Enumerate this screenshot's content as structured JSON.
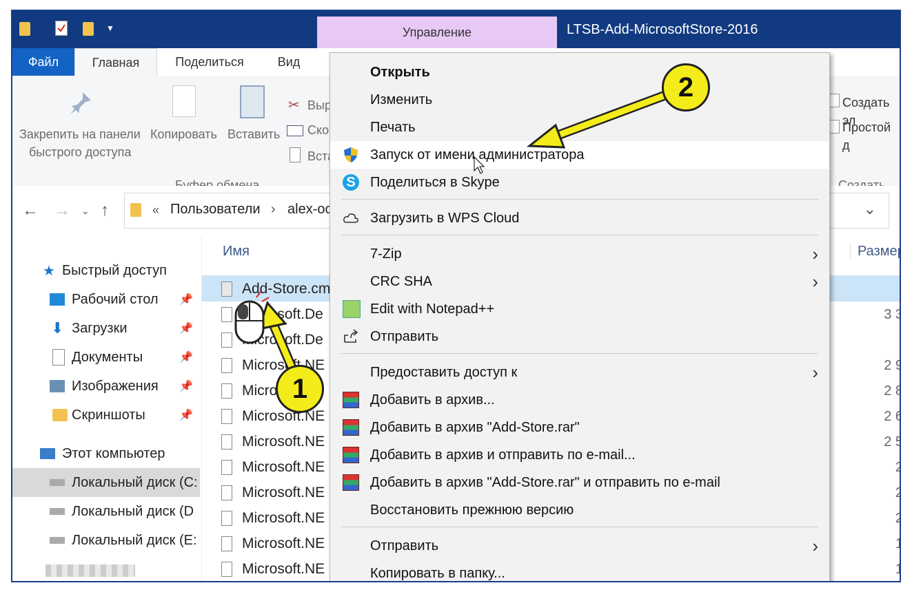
{
  "window": {
    "manage_tab": "Управление",
    "title": "LTSB-Add-MicrosoftStore-2016"
  },
  "tabs": [
    "Файл",
    "Главная",
    "Поделиться",
    "Вид"
  ],
  "ribbon": {
    "pin_label_1": "Закрепить на панели",
    "pin_label_2": "быстрого доступа",
    "copy": "Копировать",
    "paste": "Вставить",
    "cut_partial": "Выр",
    "copy_path_partial": "Ско",
    "paste_shortcut_partial": "Вста",
    "clipboard_group": "Буфер обмена",
    "new_item_partial": "Создать эл",
    "easy_access_partial": "Простой д",
    "create_group": "Создать"
  },
  "address": {
    "sep": "«",
    "crumb1": "Пользователи",
    "crumb2": "alex-oc"
  },
  "sidebar": {
    "quick_access": "Быстрый доступ",
    "items": [
      "Рабочий стол",
      "Загрузки",
      "Документы",
      "Изображения",
      "Скриншоты"
    ],
    "this_pc": "Этот компьютер",
    "drives": [
      "Локальный диск (C:",
      "Локальный диск (D",
      "Локальный диск (E:"
    ]
  },
  "filelist": {
    "col_name": "Имя",
    "col_size": "Размер",
    "rows": [
      {
        "name": "Add-Store.cm",
        "size": ""
      },
      {
        "name": "Microsoft.De",
        "size": "3 3"
      },
      {
        "name": "Microsoft.De",
        "size": ""
      },
      {
        "name": "Microsoft.NE",
        "size": "2 9"
      },
      {
        "name": "Micro",
        "size": "2 8"
      },
      {
        "name": "Microsoft.NE",
        "size": "2 6"
      },
      {
        "name": "Microsoft.NE",
        "size": "2 5"
      },
      {
        "name": "Microsoft.NE",
        "size": "2"
      },
      {
        "name": "Microsoft.NE",
        "size": "2"
      },
      {
        "name": "Microsoft.NE",
        "size": "2"
      },
      {
        "name": "Microsoft.NE",
        "size": "1"
      },
      {
        "name": "Microsoft.NE",
        "size": "1"
      }
    ]
  },
  "context_menu": {
    "open": "Открыть",
    "edit": "Изменить",
    "print": "Печать",
    "run_as_admin": "Запуск от имени администратора",
    "share_skype": "Поделиться в Skype",
    "wps_cloud": "Загрузить в WPS Cloud",
    "zip7": "7-Zip",
    "crc": "CRC SHA",
    "notepadpp": "Edit with Notepad++",
    "send_share": "Отправить",
    "grant_access": "Предоставить доступ к",
    "add_archive": "Добавить в архив...",
    "add_archive_rar": "Добавить в архив \"Add-Store.rar\"",
    "add_archive_email": "Добавить в архив и отправить по e-mail...",
    "add_archive_rar_email": "Добавить в архив \"Add-Store.rar\" и отправить по e-mail",
    "restore": "Восстановить прежнюю версию",
    "send_to": "Отправить",
    "copy_to": "Копировать в папку..."
  },
  "badges": {
    "one": "1",
    "two": "2"
  },
  "colors": {
    "titlebar": "#113a80",
    "file_tab": "#1363c5",
    "manage_tab": "#e8c8f5",
    "badge": "#f4ec1a"
  }
}
